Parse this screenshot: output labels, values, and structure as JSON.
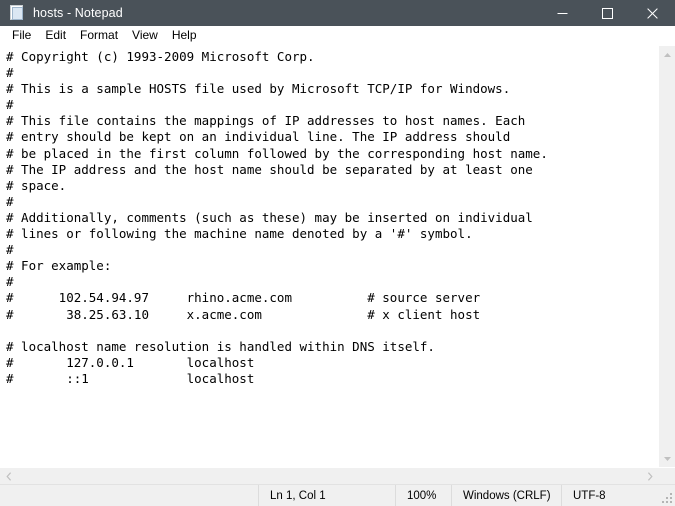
{
  "window": {
    "title": "hosts - Notepad",
    "icon": "notepad-icon",
    "controls": {
      "minimize_label": "─",
      "maximize_label": "□",
      "close_label": "✕"
    },
    "colors": {
      "titlebar_background": "#4a5259",
      "titlebar_text": "#ffffff",
      "editor_background": "#ffffff",
      "editor_text": "#000000",
      "statusbar_background": "#f0f0f0",
      "scrollbar_background": "#f0f0f0"
    }
  },
  "menu": {
    "items": [
      {
        "label": "File"
      },
      {
        "label": "Edit"
      },
      {
        "label": "Format"
      },
      {
        "label": "View"
      },
      {
        "label": "Help"
      }
    ]
  },
  "editor": {
    "lines": [
      "# Copyright (c) 1993-2009 Microsoft Corp.",
      "#",
      "# This is a sample HOSTS file used by Microsoft TCP/IP for Windows.",
      "#",
      "# This file contains the mappings of IP addresses to host names. Each",
      "# entry should be kept on an individual line. The IP address should",
      "# be placed in the first column followed by the corresponding host name.",
      "# The IP address and the host name should be separated by at least one",
      "# space.",
      "#",
      "# Additionally, comments (such as these) may be inserted on individual",
      "# lines or following the machine name denoted by a '#' symbol.",
      "#",
      "# For example:",
      "#",
      "#      102.54.94.97     rhino.acme.com          # source server",
      "#       38.25.63.10     x.acme.com              # x client host",
      "",
      "# localhost name resolution is handled within DNS itself.",
      "#\t127.0.0.1       localhost",
      "#\t::1             localhost"
    ],
    "text": "# Copyright (c) 1993-2009 Microsoft Corp.\n#\n# This is a sample HOSTS file used by Microsoft TCP/IP for Windows.\n#\n# This file contains the mappings of IP addresses to host names. Each\n# entry should be kept on an individual line. The IP address should\n# be placed in the first column followed by the corresponding host name.\n# The IP address and the host name should be separated by at least one\n# space.\n#\n# Additionally, comments (such as these) may be inserted on individual\n# lines or following the machine name denoted by a '#' symbol.\n#\n# For example:\n#\n#      102.54.94.97     rhino.acme.com          # source server\n#       38.25.63.10     x.acme.com              # x client host\n\n# localhost name resolution is handled within DNS itself.\n#       127.0.0.1       localhost\n#       ::1             localhost"
  },
  "scrollbars": {
    "vertical": {
      "up_arrow": "scroll-up-icon",
      "down_arrow": "scroll-down-icon"
    },
    "horizontal": {
      "left_arrow": "scroll-left-icon",
      "right_arrow": "scroll-right-icon"
    }
  },
  "status_bar": {
    "cursor_position": "Ln 1, Col 1",
    "zoom": "100%",
    "line_ending": "Windows (CRLF)",
    "encoding": "UTF-8"
  }
}
